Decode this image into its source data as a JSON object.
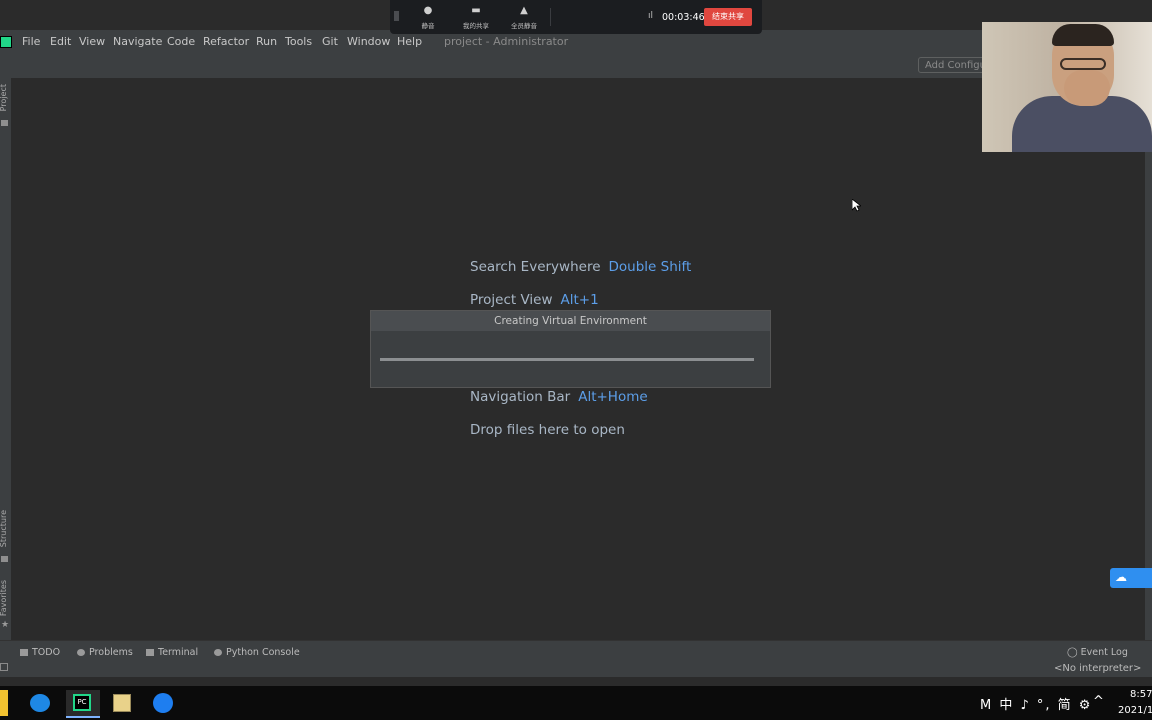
{
  "meeting": {
    "mute_label": "静音",
    "share_label": "我的共享",
    "all_mute_label": "全员静音",
    "timer": "00:03:46",
    "stop_label": "结束共享"
  },
  "menubar": {
    "items": [
      "File",
      "Edit",
      "View",
      "Navigate",
      "Code",
      "Refactor",
      "Run",
      "Tools",
      "Git",
      "Window",
      "Help"
    ],
    "project_title": "project - Administrator"
  },
  "toolbar": {
    "add_config_label": "Add Configuration..."
  },
  "side_tabs": {
    "project": "Project",
    "structure": "Structure",
    "favorites": "Favorites"
  },
  "editor_hints": [
    {
      "label": "Search Everywhere",
      "key": "Double Shift"
    },
    {
      "label": "Project View",
      "key": "Alt+1"
    },
    {
      "label": "Navigation Bar",
      "key": "Alt+Home"
    },
    {
      "label": "Drop files here to open",
      "key": ""
    }
  ],
  "dialog": {
    "title": "Creating Virtual Environment",
    "progress": 1.0
  },
  "bottom_tabs": [
    "TODO",
    "Problems",
    "Terminal",
    "Python Console"
  ],
  "event_log": "Event Log",
  "interpreter": "<No interpreter>",
  "taskbar": {
    "tray_text": "M 中 ♪ °, 简 ⚙",
    "time": "8:57",
    "date": "2021/1"
  },
  "colors": {
    "accent_key": "#5c9ee8",
    "stop_button": "#e0473f"
  }
}
